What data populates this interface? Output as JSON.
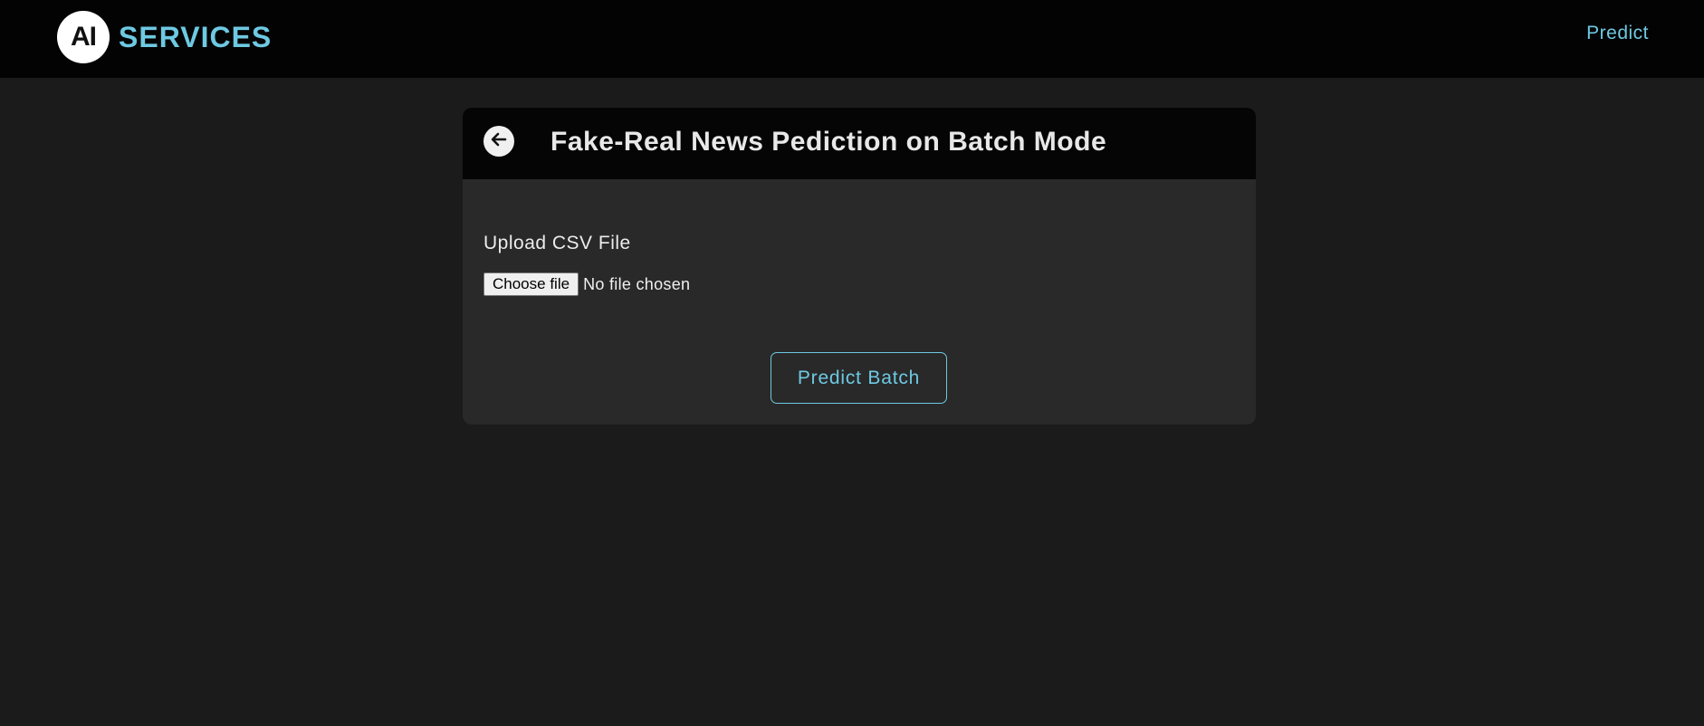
{
  "navbar": {
    "logo_text": "AI",
    "brand_text": "SERVICES",
    "nav_link": "Predict"
  },
  "card": {
    "back_icon": "arrow-left-circle-icon",
    "title": "Fake-Real News Pediction on Batch Mode",
    "upload_label": "Upload CSV File",
    "file_button_label": "Choose file",
    "file_status": "No file chosen",
    "submit_label": "Predict Batch"
  },
  "colors": {
    "background": "#1b1b1b",
    "navbar": "#030303",
    "card": "#292929",
    "card_header": "#050505",
    "accent": "#6ec9e2"
  }
}
